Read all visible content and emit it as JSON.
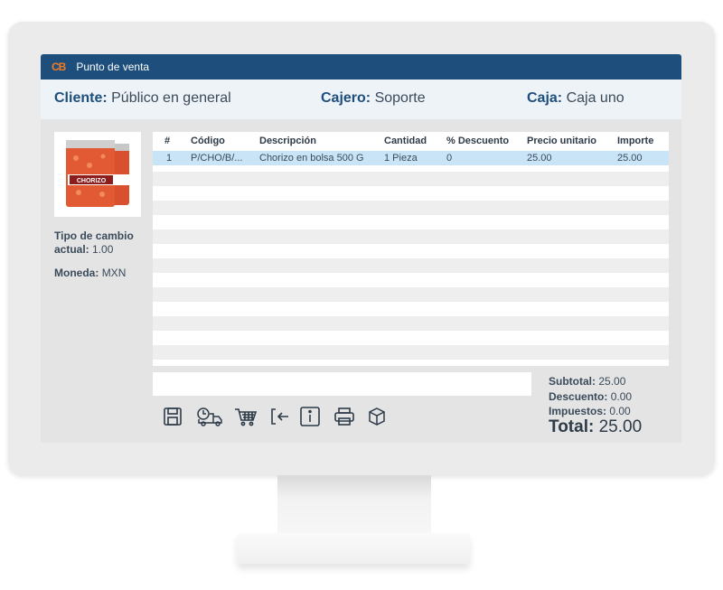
{
  "window": {
    "logo": "CB",
    "title": "Punto de venta"
  },
  "info": {
    "cliente_label": "Cliente:",
    "cliente_value": "Público en general",
    "cajero_label": "Cajero:",
    "cajero_value": "Soporte",
    "caja_label": "Caja:",
    "caja_value": "Caja uno"
  },
  "product": {
    "image_text": "CHORIZO"
  },
  "side": {
    "tipo_label_1": "Tipo de cambio",
    "tipo_label_2": "actual:",
    "tipo_value": "1.00",
    "moneda_label": "Moneda:",
    "moneda_value": "MXN"
  },
  "table": {
    "columns": [
      "#",
      "Código",
      "Descripción",
      "Cantidad",
      "% Descuento",
      "Precio unitario",
      "Importe"
    ],
    "rows": [
      [
        "1",
        "P/CHO/B/...",
        "Chorizo en bolsa 500 G",
        "1 Pieza",
        "0",
        "25.00",
        "25.00"
      ]
    ]
  },
  "search": {
    "value": ""
  },
  "toolbar": {
    "icons": [
      "save-icon",
      "delivery-truck-icon",
      "shopping-cart-icon",
      "exit-icon",
      "info-icon",
      "printer-icon",
      "box-icon"
    ]
  },
  "totals": {
    "subtotal_label": "Subtotal:",
    "subtotal_value": "25.00",
    "descuento_label": "Descuento:",
    "descuento_value": "0.00",
    "impuestos_label": "Impuestos:",
    "impuestos_value": "0.00",
    "total_label": "Total:",
    "total_value": "25.00"
  },
  "colors": {
    "titlebar": "#1e4f7c",
    "accent": "#f47b20",
    "selected_row": "#c9e4f6"
  }
}
